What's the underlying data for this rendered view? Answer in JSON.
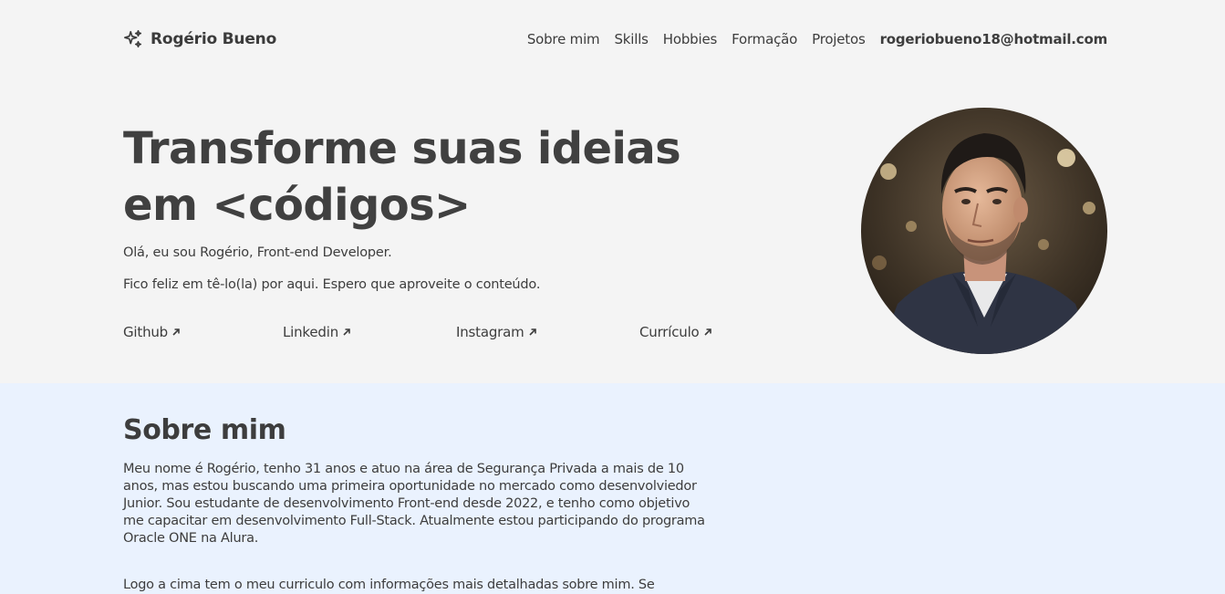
{
  "header": {
    "brand_name": "Rogério Bueno",
    "brand_icon": "sparkles-icon",
    "nav": [
      {
        "label": "Sobre mim"
      },
      {
        "label": "Skills"
      },
      {
        "label": "Hobbies"
      },
      {
        "label": "Formação"
      },
      {
        "label": "Projetos"
      },
      {
        "label": "rogeriobueno18@hotmail.com"
      }
    ]
  },
  "hero": {
    "title_line1": "Transforme suas ideias",
    "title_line2": "em <códigos>",
    "intro": "Olá, eu sou Rogério, Front-end Developer.",
    "welcome": "Fico feliz em tê-lo(la) por aqui. Espero que aproveite o conteúdo.",
    "links": [
      {
        "label": "Github",
        "icon": "arrow-up-right-icon"
      },
      {
        "label": "Linkedin",
        "icon": "arrow-up-right-icon"
      },
      {
        "label": "Instagram",
        "icon": "arrow-up-right-icon"
      },
      {
        "label": "Currículo",
        "icon": "arrow-up-right-icon"
      }
    ]
  },
  "about": {
    "title": "Sobre mim",
    "paragraph1": "Meu nome é Rogério, tenho 31 anos e atuo na área de Segurança Privada a mais de 10 anos, mas estou buscando uma primeira oportunidade no mercado como desenvolviedor Junior. Sou estudante de desenvolvimento Front-end desde 2022, e tenho como objetivo me capacitar em desenvolvimento Full-Stack. Atualmente estou participando do programa Oracle ONE na Alura.",
    "paragraph2": "Logo a cima tem o meu curriculo com informações mais detalhadas sobre mim. Se"
  },
  "colors": {
    "page_background": "#f4f4f4",
    "about_background": "#eaf2fe",
    "text": "#3d3d3d"
  }
}
